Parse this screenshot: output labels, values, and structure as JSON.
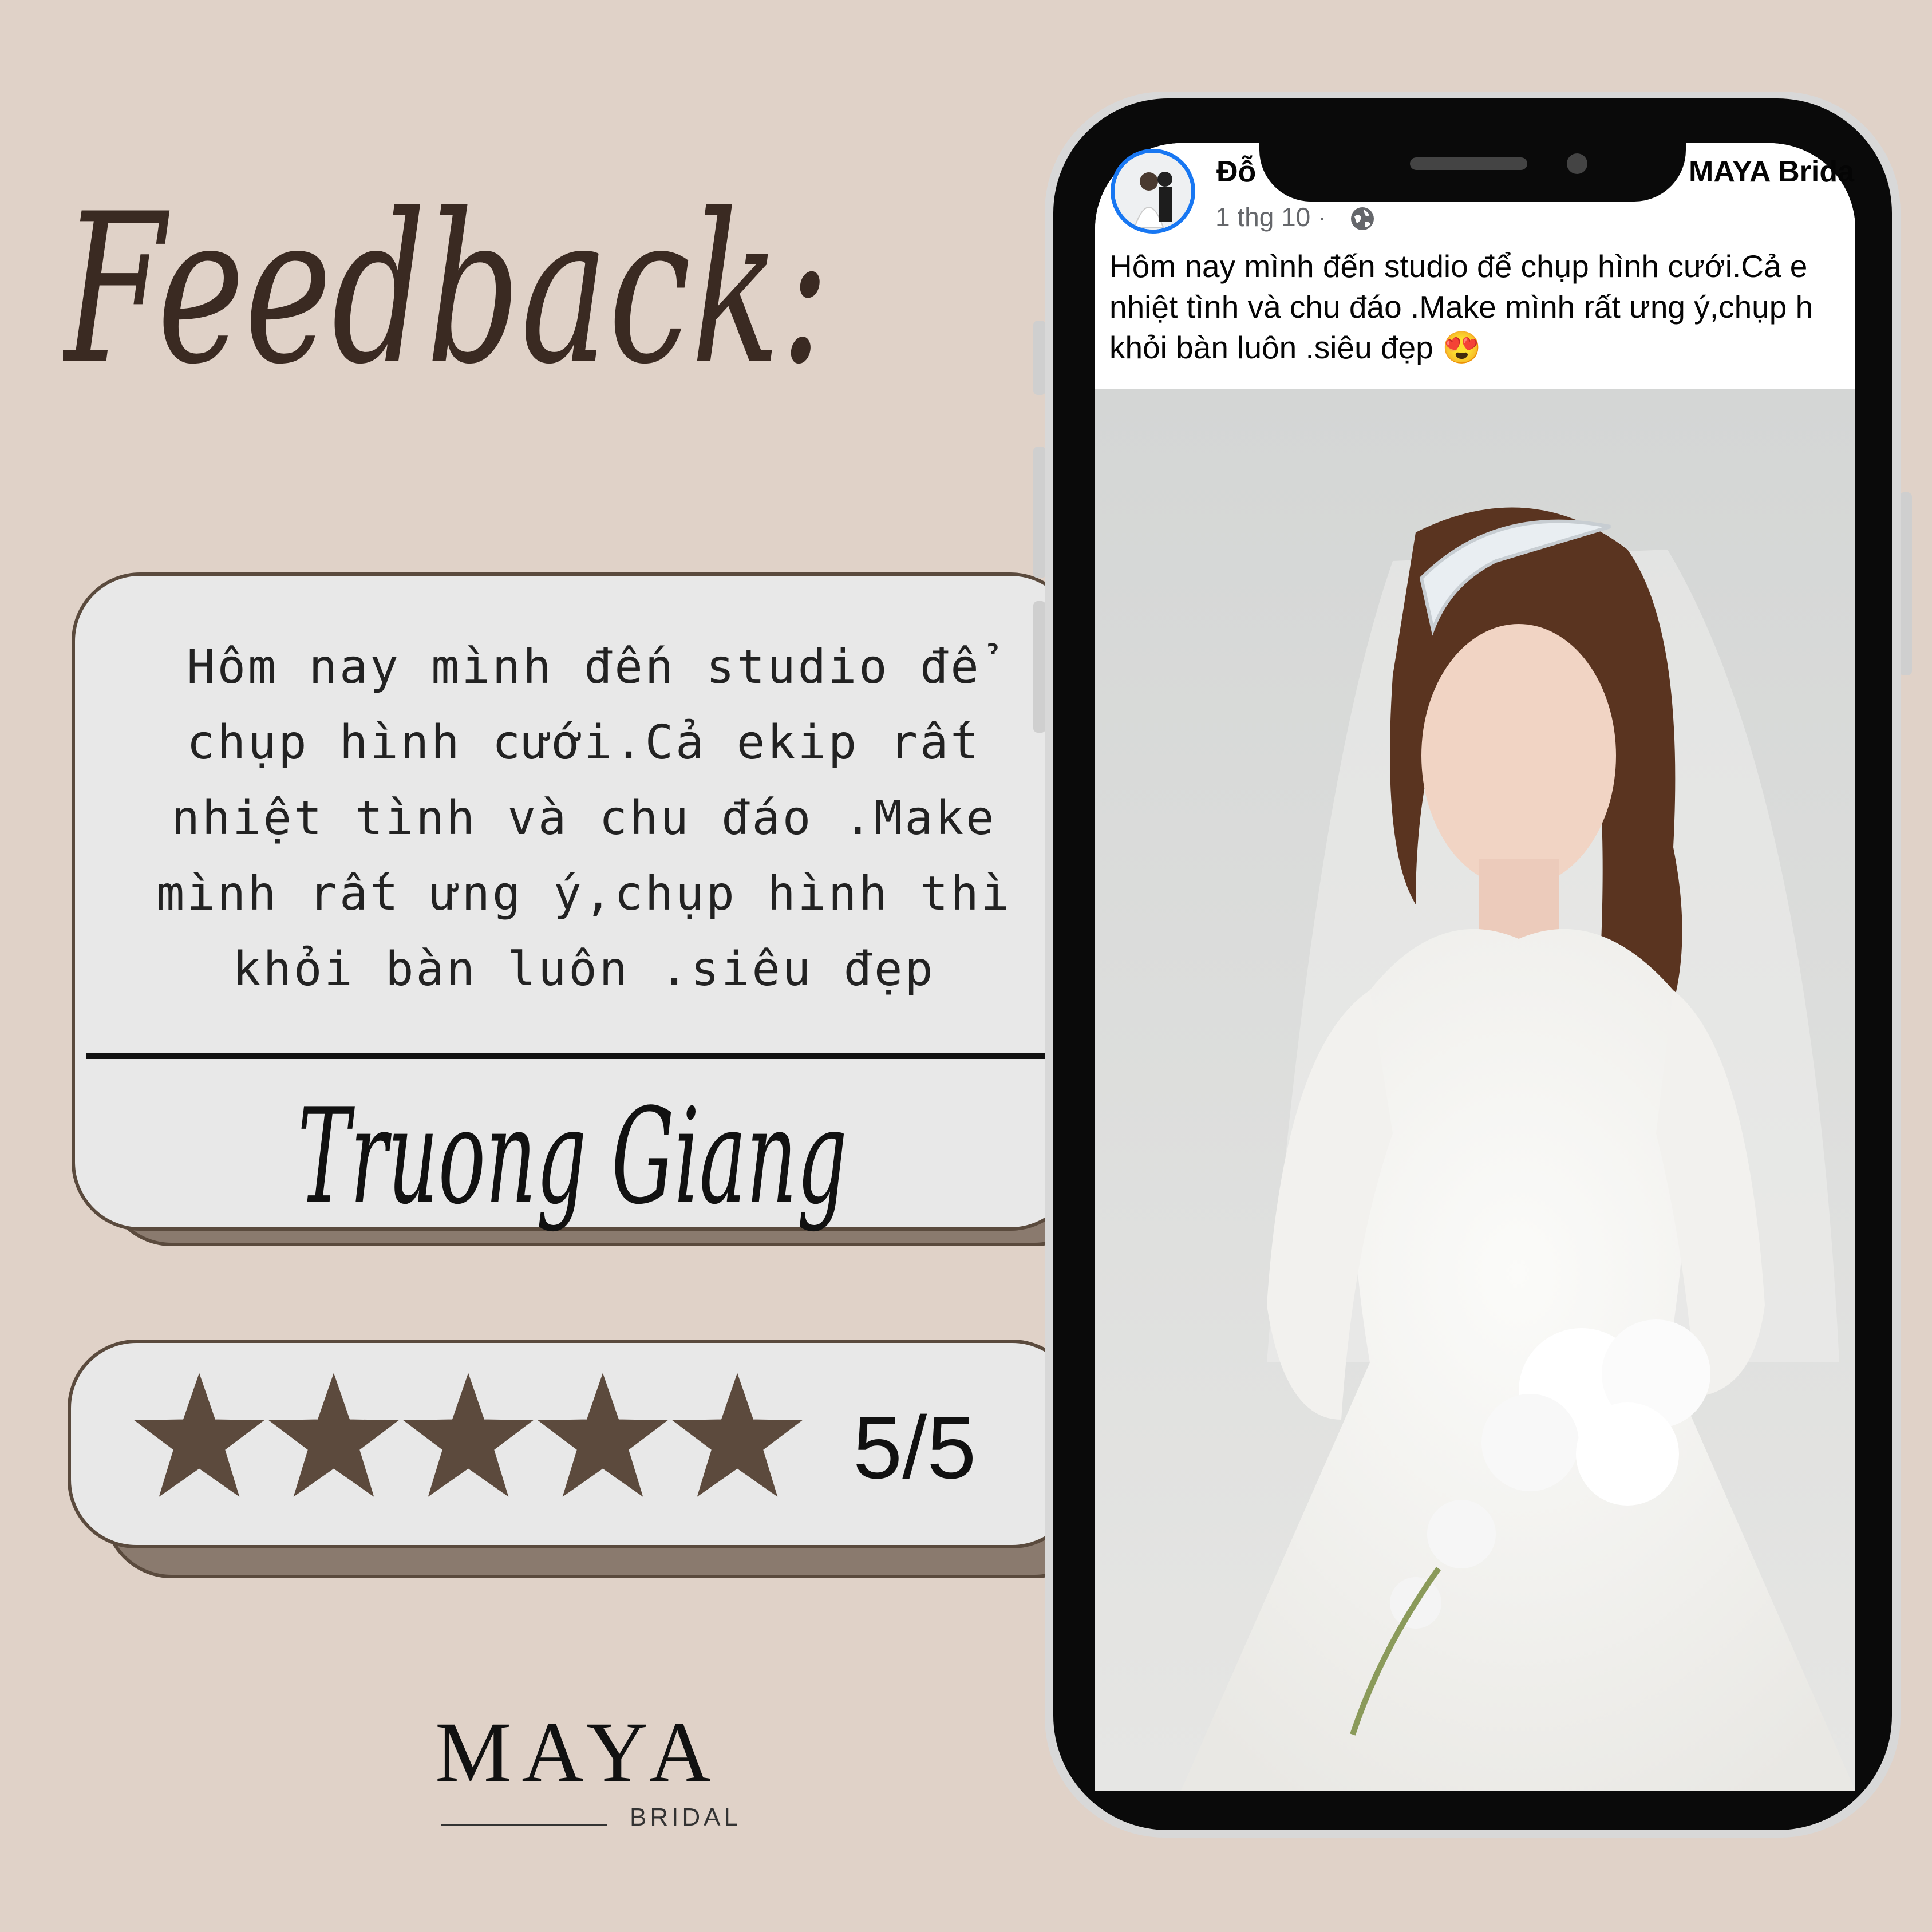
{
  "title": "Feedback:",
  "review": {
    "text": "Hôm nay mình đến studio để\nchụp hình cưới.Cả ekip rất\nnhiệt tình và chu đáo .Make\nmình rất ưng ý,chụp hình thì\nkhỏi bàn luôn .siêu đẹp",
    "reviewer": "Truong Giang"
  },
  "rating": {
    "stars": 5,
    "max": 5,
    "label": "5/5",
    "star_color": "#5c4a3d"
  },
  "brand": {
    "name": "MAYA",
    "sub": "BRIDAL"
  },
  "post": {
    "author_visible": "Đỗ",
    "page_visible": "MAYA Brida",
    "date": "1 thg 10 ·",
    "privacy_icon": "globe-icon",
    "text_lines": [
      "Hôm nay mình đến studio để chụp hình cưới.Cả e",
      "nhiệt tình và chu đáo .Make mình rất ưng ý,chụp h",
      "khỏi bàn luôn .siêu đẹp 😍"
    ]
  },
  "colors": {
    "background": "#e0d2c8",
    "card": "#e8e8e8",
    "card_border": "#5a4a3d",
    "card_shadow": "#8a7a6e",
    "accent_blue": "#1877f2"
  }
}
